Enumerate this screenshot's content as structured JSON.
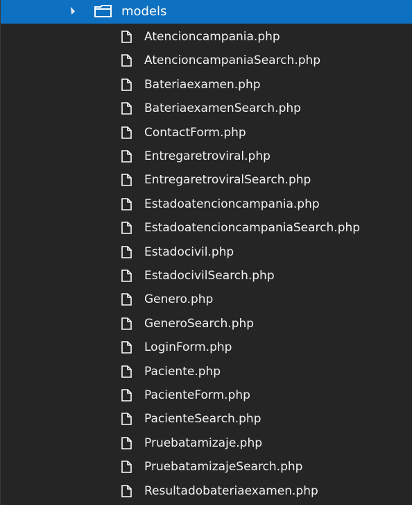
{
  "explorer": {
    "folder": {
      "name": "models",
      "icon": "folder-icon",
      "expanded": true,
      "selected": true
    },
    "files": [
      "Atencioncampania.php",
      "AtencioncampaniaSearch.php",
      "Bateriaexamen.php",
      "BateriaexamenSearch.php",
      "ContactForm.php",
      "Entregaretroviral.php",
      "EntregaretroviralSearch.php",
      "Estadoatencioncampania.php",
      "EstadoatencioncampaniaSearch.php",
      "Estadocivil.php",
      "EstadocivilSearch.php",
      "Genero.php",
      "GeneroSearch.php",
      "LoginForm.php",
      "Paciente.php",
      "PacienteForm.php",
      "PacienteSearch.php",
      "Pruebatamizaje.php",
      "PruebatamizajeSearch.php",
      "Resultadobateriaexamen.php"
    ],
    "file_icon": "file-icon",
    "colors": {
      "background": "#252526",
      "selection": "#0e70c0",
      "text": "#f1f1f1"
    }
  }
}
